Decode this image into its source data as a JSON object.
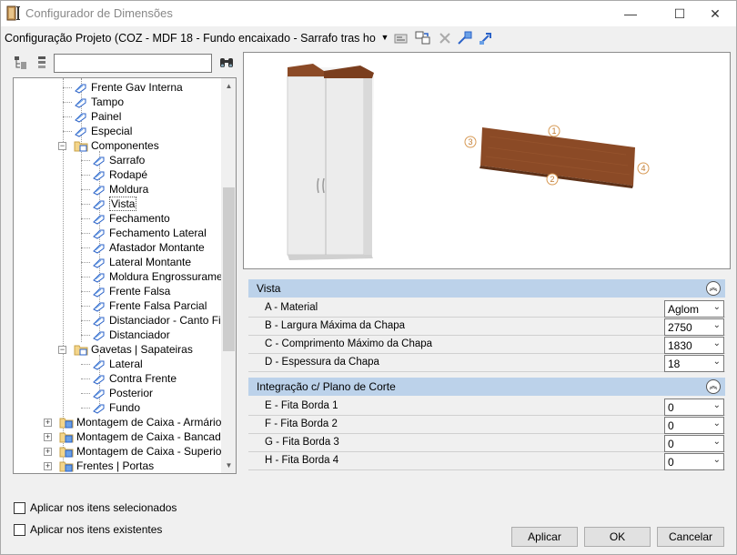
{
  "window": {
    "title": "Configurador de Dimensões"
  },
  "config": {
    "label": "Configuração Projeto (COZ - MDF 18 - Fundo encaixado - Sarrafo tras horizontal"
  },
  "tree": {
    "items": [
      "Frente Gav Interna",
      "Tampo",
      "Painel",
      "Especial",
      "Componentes",
      "Sarrafo",
      "Rodapé",
      "Moldura",
      "Vista",
      "Fechamento",
      "Fechamento Lateral",
      "Afastador Montante",
      "Lateral Montante",
      "Moldura Engrossuramento",
      "Frente Falsa",
      "Frente Falsa Parcial",
      "Distanciador - Canto Fixo",
      "Distanciador",
      "Gavetas | Sapateiras",
      "Lateral",
      "Contra Frente",
      "Posterior",
      "Fundo",
      "Montagem de Caixa - Armários",
      "Montagem de Caixa - Bancadas",
      "Montagem de Caixa - Superiores",
      "Frentes | Portas"
    ]
  },
  "preview": {
    "markers": [
      "1",
      "2",
      "3",
      "4"
    ]
  },
  "groups": [
    {
      "title": "Vista",
      "rows": [
        {
          "label": "A - Material",
          "value": "Aglom"
        },
        {
          "label": "B - Largura Máxima da Chapa",
          "value": "2750"
        },
        {
          "label": "C - Comprimento Máximo da Chapa",
          "value": "1830"
        },
        {
          "label": "D - Espessura da Chapa",
          "value": "18"
        }
      ]
    },
    {
      "title": "Integração c/ Plano de Corte",
      "rows": [
        {
          "label": "E - Fita Borda 1",
          "value": "0"
        },
        {
          "label": "F - Fita Borda 2",
          "value": "0"
        },
        {
          "label": "G - Fita Borda 3",
          "value": "0"
        },
        {
          "label": "H - Fita Borda 4",
          "value": "0"
        }
      ]
    }
  ],
  "options": {
    "apply_selected": "Aplicar nos itens selecionados",
    "apply_existing": "Aplicar nos itens existentes"
  },
  "buttons": {
    "apply": "Aplicar",
    "ok": "OK",
    "cancel": "Cancelar"
  },
  "colors": {
    "wood": "#8b4a26",
    "group_header": "#bcd2ea",
    "cabinet": "#e8e8e8"
  }
}
